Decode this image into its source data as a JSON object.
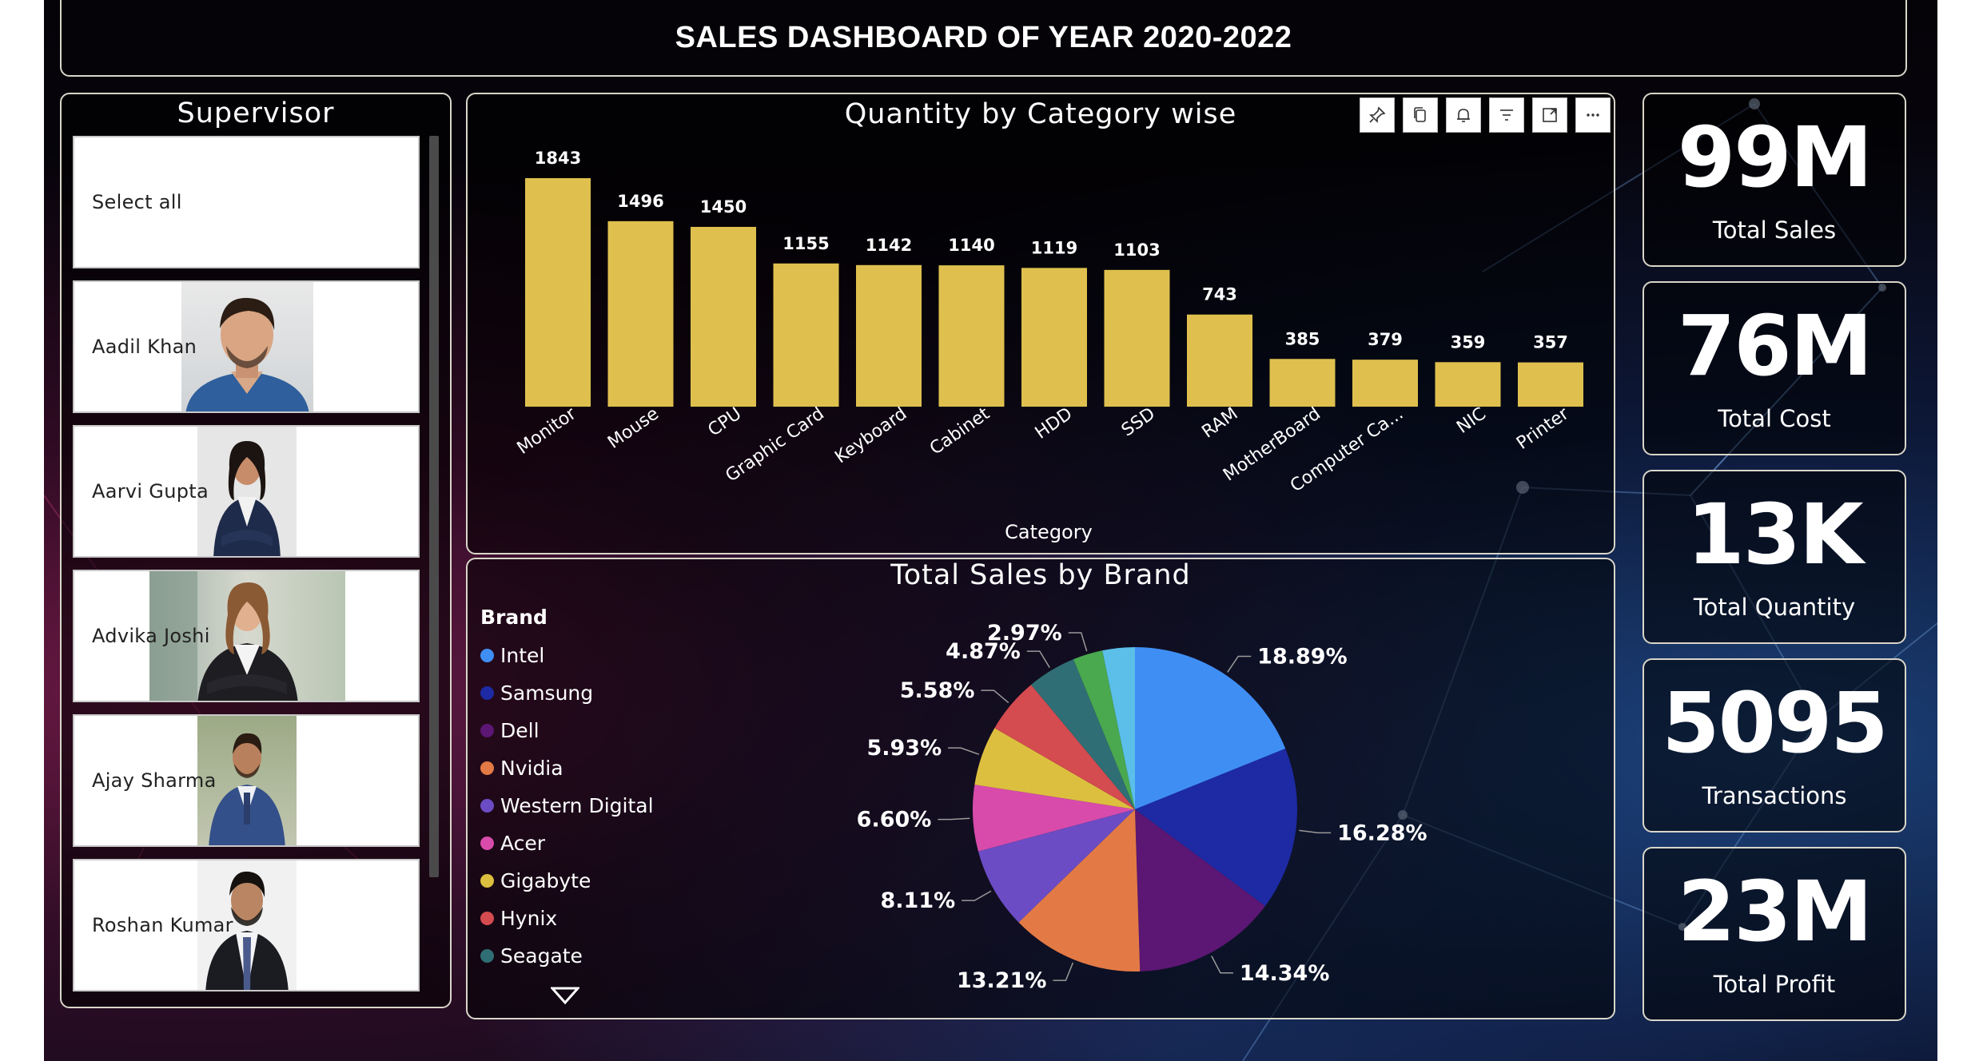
{
  "header": {
    "title": "SALES DASHBOARD OF YEAR 2020-2022"
  },
  "supervisor": {
    "title": "Supervisor",
    "items": [
      {
        "label": "Select all"
      },
      {
        "label": "Aadil Khan"
      },
      {
        "label": "Aarvi Gupta"
      },
      {
        "label": "Advika Joshi"
      },
      {
        "label": "Ajay Sharma"
      },
      {
        "label": "Roshan Kumar"
      }
    ]
  },
  "bar_panel": {
    "title": "Quantity by Category wise",
    "toolbar": [
      "pin-icon",
      "copy-icon",
      "bell-icon",
      "filter-icon",
      "focus-mode-icon",
      "more-options-icon"
    ]
  },
  "pie_panel": {
    "title": "Total Sales by Brand"
  },
  "kpis": [
    {
      "value": "99M",
      "label": "Total Sales"
    },
    {
      "value": "76M",
      "label": "Total Cost"
    },
    {
      "value": "13K",
      "label": "Total Quantity"
    },
    {
      "value": "5095",
      "label": "Transactions"
    },
    {
      "value": "23M",
      "label": "Total Profit"
    }
  ],
  "colors": {
    "bar": "#dfc04e",
    "accent_border": "#d9d6c9"
  },
  "chart_data": [
    {
      "type": "bar",
      "title": "Quantity by Category wise",
      "xlabel": "Category",
      "ylabel": "",
      "categories": [
        "Monitor",
        "Mouse",
        "CPU",
        "Graphic Card",
        "Keyboard",
        "Cabinet",
        "HDD",
        "SSD",
        "RAM",
        "MotherBoard",
        "Computer Ca...",
        "NIC",
        "Printer"
      ],
      "values": [
        1843,
        1496,
        1450,
        1155,
        1142,
        1140,
        1119,
        1103,
        743,
        385,
        379,
        359,
        357
      ],
      "ylim": [
        0,
        1843
      ],
      "grid": false
    },
    {
      "type": "pie",
      "title": "Total Sales by Brand",
      "legend_title": "Brand",
      "legend_position": "left",
      "legend": [
        "Intel",
        "Samsung",
        "Dell",
        "Nvidia",
        "Western Digital",
        "Acer",
        "Gigabyte",
        "Hynix",
        "Seagate"
      ],
      "slices": [
        {
          "name": "Intel",
          "value": 18.89,
          "label": "18.89%",
          "color": "#3f8ef4"
        },
        {
          "name": "Samsung",
          "value": 16.28,
          "label": "16.28%",
          "color": "#1d2aa3"
        },
        {
          "name": "Dell",
          "value": 14.34,
          "label": "14.34%",
          "color": "#5c1673"
        },
        {
          "name": "Nvidia",
          "value": 13.21,
          "label": "13.21%",
          "color": "#e37a45"
        },
        {
          "name": "Western Digital",
          "value": 8.11,
          "label": "8.11%",
          "color": "#6b4cc4"
        },
        {
          "name": "Acer",
          "value": 6.6,
          "label": "6.60%",
          "color": "#d84bab"
        },
        {
          "name": "Gigabyte",
          "value": 5.93,
          "label": "5.93%",
          "color": "#ddbf3f"
        },
        {
          "name": "Hynix",
          "value": 5.58,
          "label": "5.58%",
          "color": "#d44b50"
        },
        {
          "name": "Seagate",
          "value": 4.87,
          "label": "4.87%",
          "color": "#2f6e74"
        },
        {
          "name": "",
          "value": 2.97,
          "label": "2.97%",
          "color": "#4aa84f"
        },
        {
          "name": "",
          "value": 3.22,
          "label": "",
          "color": "#5bbfe9"
        }
      ]
    }
  ]
}
